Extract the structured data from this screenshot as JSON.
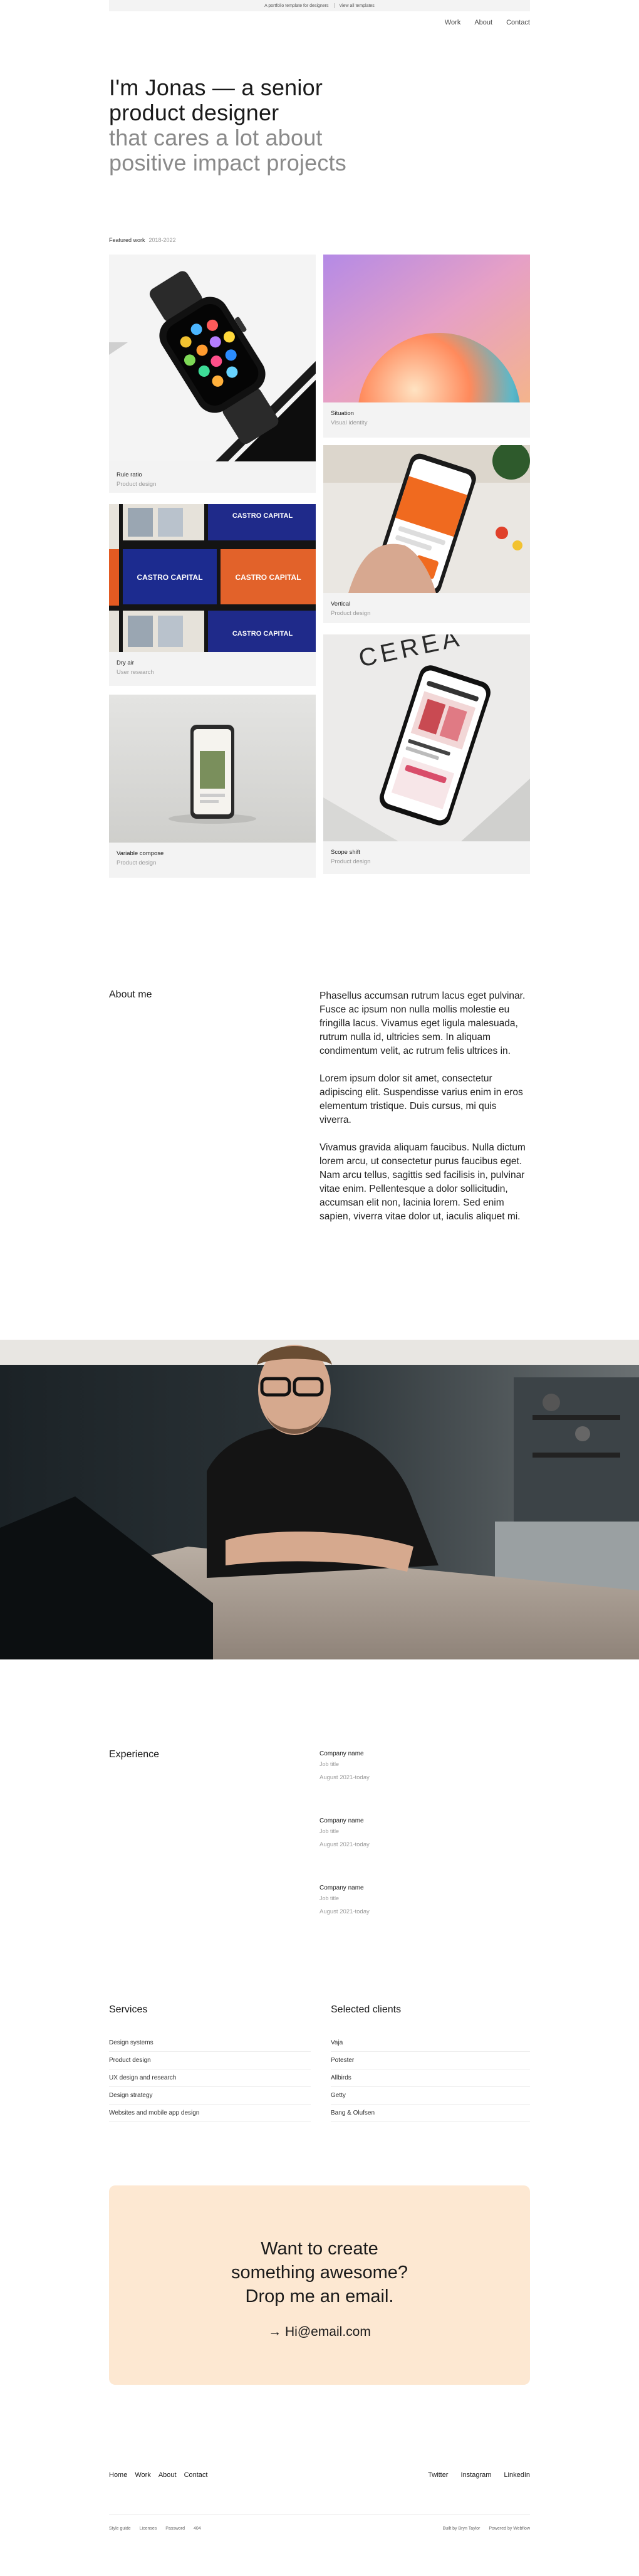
{
  "topbar": {
    "left": "A portfolio template for designers",
    "right": "View all templates"
  },
  "nav": [
    {
      "label": "Work"
    },
    {
      "label": "About"
    },
    {
      "label": "Contact"
    }
  ],
  "hero": {
    "line1": "I'm Jonas — a senior",
    "line2": "product designer",
    "line3": "that cares a lot about",
    "line4": "positive impact projects"
  },
  "featured": {
    "label": "Featured work",
    "years": "2018-2022"
  },
  "projects": [
    {
      "title": "Rule ratio",
      "subtitle": "Product design"
    },
    {
      "title": "Situation",
      "subtitle": "Visual identity"
    },
    {
      "title": "Dry air",
      "subtitle": "User research"
    },
    {
      "title": "Vertical",
      "subtitle": "Product design"
    },
    {
      "title": "Variable compose",
      "subtitle": "Product design"
    },
    {
      "title": "Scope shift",
      "subtitle": "Product design"
    }
  ],
  "castro": {
    "text": "CASTRO CAPITAL"
  },
  "cerea": {
    "text": "CEREA"
  },
  "about": {
    "title": "About me",
    "p1": "Phasellus accumsan rutrum lacus eget pulvinar. Fusce ac ipsum non nulla mollis molestie eu fringilla lacus. Vivamus eget ligula malesuada, rutrum nulla id, ultricies sem. In aliquam condimentum velit, ac rutrum felis ultrices in.",
    "p2": "Lorem ipsum dolor sit amet, consectetur adipiscing elit. Suspendisse varius enim in eros elementum tristique. Duis cursus, mi quis viverra.",
    "p3": "Vivamus gravida aliquam faucibus. Nulla dictum lorem arcu, ut consectetur purus faucibus eget. Nam arcu tellus, sagittis sed facilisis in, pulvinar vitae enim. Pellentesque a dolor sollicitudin, accumsan elit non, lacinia lorem. Sed enim sapien, viverra vitae dolor ut, iaculis aliquet mi."
  },
  "experience": {
    "title": "Experience",
    "items": [
      {
        "company": "Company name",
        "job": "Job title",
        "dates": "August 2021-today"
      },
      {
        "company": "Company name",
        "job": "Job title",
        "dates": "August 2021-today"
      },
      {
        "company": "Company name",
        "job": "Job title",
        "dates": "August 2021-today"
      }
    ]
  },
  "services": {
    "title": "Services",
    "items": [
      "Design systems",
      "Product design",
      "UX design and research",
      "Design strategy",
      "Websites and mobile app design"
    ]
  },
  "clients": {
    "title": "Selected clients",
    "items": [
      "Vaja",
      "Potester",
      "Allbirds",
      "Getty",
      "Bang & Olufsen"
    ]
  },
  "cta": {
    "line1": "Want to create",
    "line2": "something awesome?",
    "line3": "Drop me an email.",
    "email": "→ Hi@email.com"
  },
  "footer": {
    "left": [
      "Home",
      "Work",
      "About",
      "Contact"
    ],
    "right": [
      "Twitter",
      "Instagram",
      "LinkedIn"
    ],
    "bottom_left": [
      "Style guide",
      "Licenses",
      "Password",
      "404"
    ],
    "bottom_right": [
      "Built by Bryn Taylor",
      "Powered by Webflow"
    ]
  },
  "colors": {
    "accent_cta": "#fde8d2",
    "card_bg": "#f3f3f3",
    "muted_text": "#8a8a8a"
  }
}
